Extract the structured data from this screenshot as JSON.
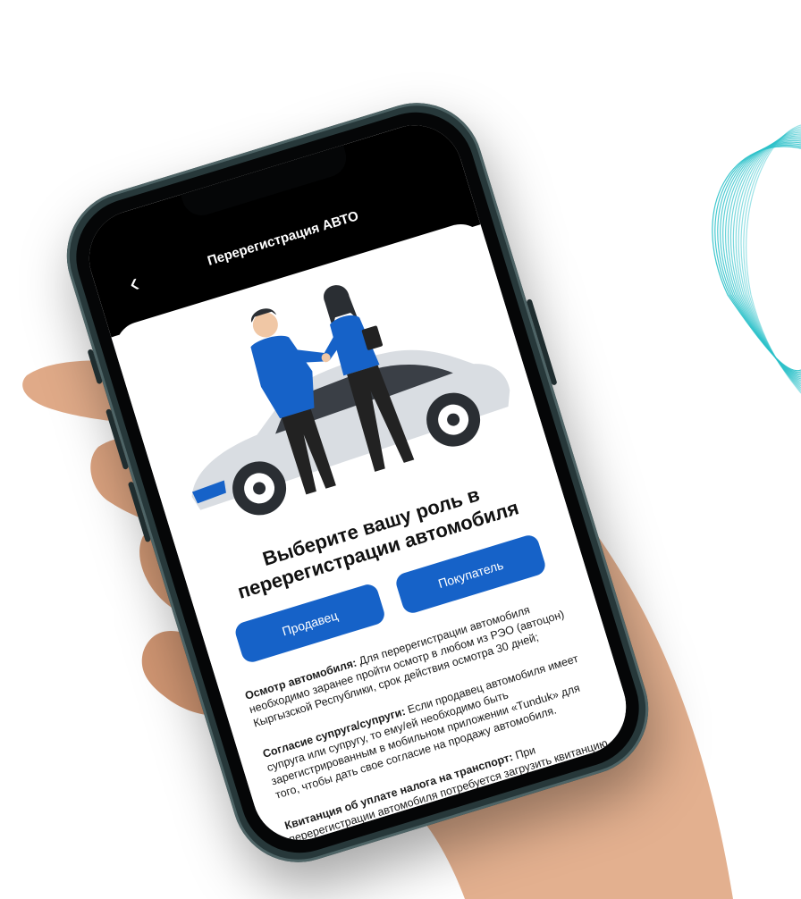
{
  "header": {
    "title": "Перерегистрация АВТО",
    "back_icon": "chevron-left-icon"
  },
  "main": {
    "heading": "Выберите вашу роль в перерегистрации автомобиля",
    "buttons": {
      "seller": "Продавец",
      "buyer": "Покупатель"
    },
    "info": [
      {
        "title": "Осмотр автомобиля:",
        "text": " Для перерегистрации автомобиля необходимо заранее пройти осмотр в любом из РЭО (автоцон) Кыргызской Республики, срок действия осмотра 30 дней;"
      },
      {
        "title": "Согласие супруга/супруги:",
        "text": " Если продавец автомобиля имеет супруга или супругу, то ему/ей необходимо быть зарегистрированным в мобильном приложении «Tunduk» для того, чтобы дать свое согласие на продажу автомобиля."
      },
      {
        "title": "Квитанция об уплате налога на транспорт:",
        "text": " При перерегистрации автомобиля потребуется загрузить квитанцию об уплате налога на транспорт."
      }
    ]
  },
  "colors": {
    "accent": "#1662c8",
    "frame": "#27383a",
    "decor": "#2cc1c9"
  }
}
